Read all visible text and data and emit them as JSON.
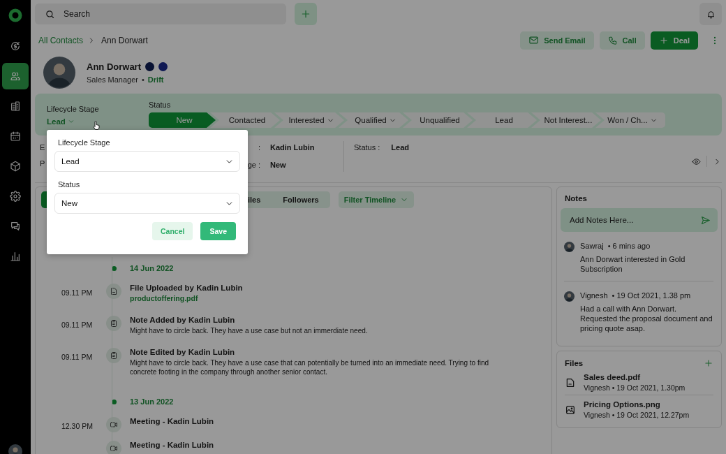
{
  "sidebar": {
    "items": [
      {
        "selected": false
      },
      {
        "selected": true
      },
      {
        "selected": false
      },
      {
        "selected": false
      },
      {
        "selected": false
      },
      {
        "selected": false
      },
      {
        "selected": false
      },
      {
        "selected": false
      }
    ]
  },
  "search": {
    "placeholder": "Search"
  },
  "breadcrumb": {
    "parent": "All Contacts",
    "current": "Ann Dorwart"
  },
  "actions": [
    {
      "kind": "email",
      "label": "Send Email"
    },
    {
      "kind": "call",
      "label": "Call"
    },
    {
      "kind": "primary",
      "label": "Deal"
    }
  ],
  "profile": {
    "name": "Ann Dorwart",
    "role": "Sales Manager",
    "separator": "•",
    "company": "Drift"
  },
  "status_panel": {
    "lifecycle_label": "Lifecycle Stage",
    "lifecycle_value": "Lead",
    "status_label": "Status",
    "steps": [
      {
        "label": "New",
        "selected": true,
        "menu": false
      },
      {
        "label": "Contacted",
        "selected": false,
        "menu": false
      },
      {
        "label": "Interested",
        "selected": false,
        "menu": true
      },
      {
        "label": "Qualified",
        "selected": false,
        "menu": true
      },
      {
        "label": "Unqualified",
        "selected": false,
        "menu": false
      },
      {
        "label": "Lead",
        "selected": false,
        "menu": false
      },
      {
        "label": "Not Interest...",
        "selected": false,
        "menu": false
      },
      {
        "label": "Won / Ch...",
        "selected": false,
        "menu": true
      }
    ]
  },
  "info": {
    "left_labels": [
      "E",
      "P"
    ],
    "middle": [
      {
        "label": ":",
        "value": "Kadin Lubin"
      },
      {
        "label": "ge :",
        "value": "New"
      }
    ],
    "right": {
      "label": "Status :",
      "value": "Lead"
    }
  },
  "timeline": {
    "tabs": [
      {
        "selected": true
      },
      {
        "label": "iles",
        "selected": false
      },
      {
        "label": "Followers",
        "selected": false
      }
    ],
    "filter": "Filter Timeline",
    "groups": [
      {
        "date": "14 Jun 2022",
        "items": [
          {
            "kind": "file",
            "time": "09.11 PM",
            "title": "File Uploaded by Kadin Lubin",
            "link": "productoffering.pdf"
          },
          {
            "kind": "note",
            "time": "09.11 PM",
            "title": "Note Added by Kadin Lubin",
            "text": "Might have to circle back. They have a use case but not an immerdiate need."
          },
          {
            "kind": "note",
            "time": "09.11 PM",
            "title": "Note Edited by Kadin Lubin",
            "text": "Might have to circle back. They have a use case that can potentially be turned into an immediate need. Trying to find concrete footing in the company through another senior contact."
          }
        ]
      },
      {
        "date": "13 Jun 2022",
        "items": [
          {
            "kind": "meeting",
            "time": "12.30 PM",
            "title": "Meeting - Kadin Lubin"
          },
          {
            "kind": "meeting",
            "title": "Meeting - Kadin Lubin"
          }
        ]
      }
    ]
  },
  "notes": {
    "title": "Notes",
    "placeholder": "Add Notes Here...",
    "entries": [
      {
        "author": "Sawraj",
        "time": "• 6 mins ago",
        "text": "Ann Dorwart interested in Gold Subscription"
      },
      {
        "author": "Vignesh",
        "time": "•  19 Oct 2021, 1.38 pm",
        "text": "Had a call with Ann Dorwart. Requested the proposal document and pricing quote asap."
      }
    ]
  },
  "files": {
    "title": "Files",
    "entries": [
      {
        "kind": "document",
        "name": "Sales deed.pdf",
        "meta": "Vignesh  •  19 Oct 2021, 1.30pm"
      },
      {
        "kind": "image",
        "name": "Pricing Options.png",
        "meta": "Vignesh  •  19 Oct 2021, 12.27pm"
      }
    ]
  },
  "popup": {
    "fields": [
      {
        "label": "Lifecycle Stage",
        "value": "Lead"
      },
      {
        "label": "Status",
        "value": "New"
      }
    ],
    "cancel": "Cancel",
    "save": "Save"
  }
}
